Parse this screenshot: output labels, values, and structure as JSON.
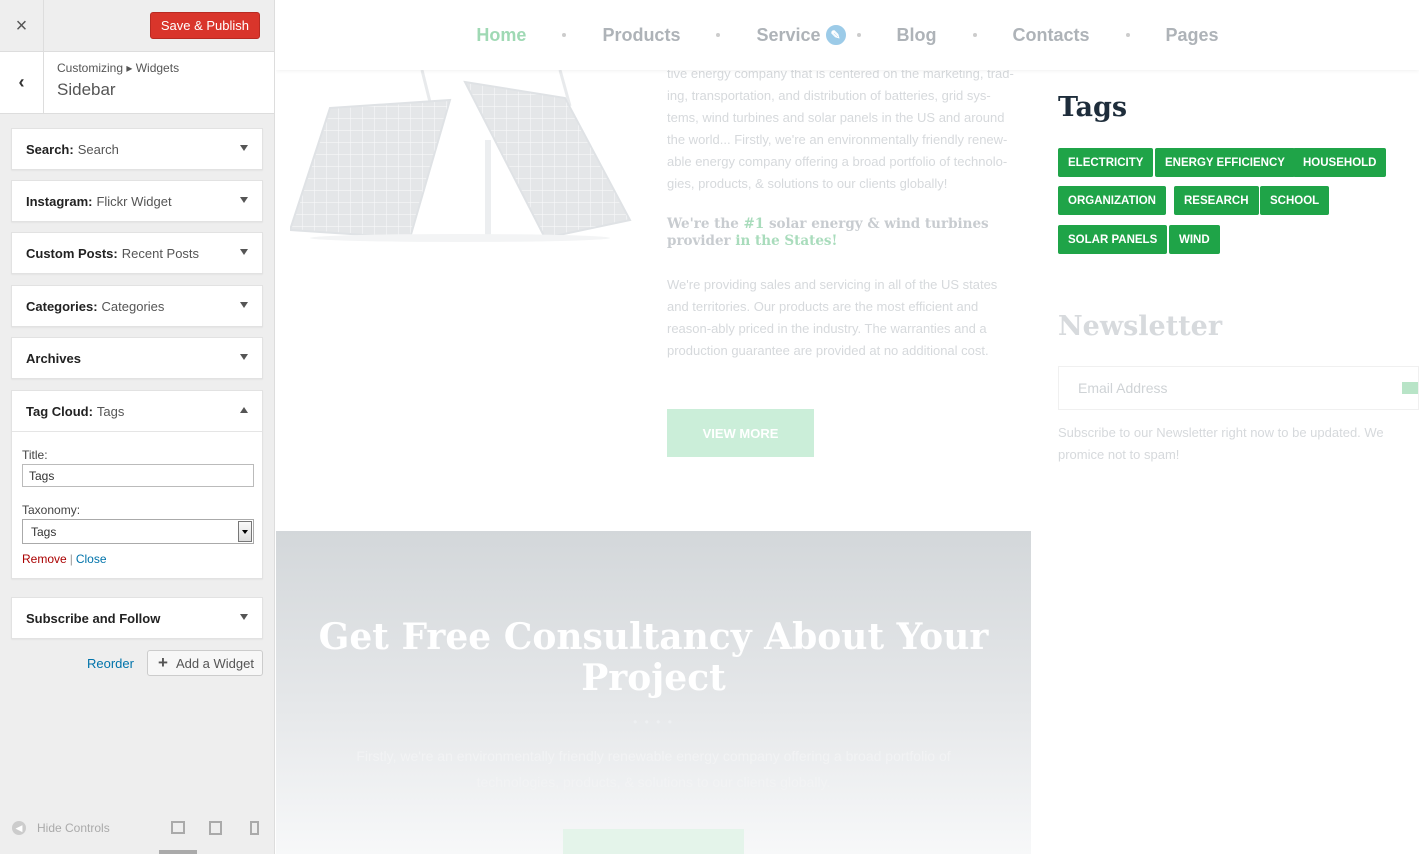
{
  "customizer": {
    "close_label": "×",
    "publish_label": "Save & Publish",
    "breadcrumb": "Customizing ▸ Widgets",
    "section_title": "Sidebar",
    "widgets": [
      {
        "type": "Search:",
        "name": "Search"
      },
      {
        "type": "Instagram:",
        "name": "Flickr Widget"
      },
      {
        "type": "Custom Posts:",
        "name": "Recent Posts"
      },
      {
        "type": "Categories:",
        "name": "Categories"
      },
      {
        "type": "Archives",
        "name": ""
      },
      {
        "type": "Tag Cloud:",
        "name": "Tags"
      },
      {
        "type": "Subscribe and Follow",
        "name": ""
      }
    ],
    "tag_cloud_form": {
      "title_label": "Title:",
      "title_value": "Tags",
      "taxonomy_label": "Taxonomy:",
      "taxonomy_value": "Tags",
      "remove_label": "Remove",
      "separator": "|",
      "close_label": "Close"
    },
    "reorder_label": "Reorder",
    "add_widget_label": "Add a Widget",
    "hide_controls_label": "Hide Controls"
  },
  "preview": {
    "nav": [
      "Home",
      "Products",
      "Service",
      "Blog",
      "Contacts",
      "Pages"
    ],
    "about_text": "tive energy company that is centered on the marketing, trad-ing, transportation, and distribution of batteries, grid sys-tems, wind turbines and solar panels in the US and around the world... Firstly, we're an environmentally friendly renew-able energy company offering a broad portfolio of technolo-gies, products, & solutions to our clients globally!",
    "strong_prefix": "We're the ",
    "strong_highlight1": "#1",
    "strong_middle": " solar energy & wind turbines provider ",
    "strong_highlight2": "in the States!",
    "about_text2": "We're providing sales and servicing in all of the US states and territories. Our products are the most efficient and reason-ably priced in the industry. The warranties and a production guarantee are provided at no additional cost.",
    "view_more": "VIEW MORE",
    "tags_title": "Tags",
    "tags": [
      "ELECTRICITY",
      "ENERGY EFFICIENCY",
      "HOUSEHOLD",
      "ORGANIZATION",
      "RESEARCH",
      "SCHOOL",
      "SOLAR PANELS",
      "WIND"
    ],
    "newsletter_title": "Newsletter",
    "email_placeholder": "Email Address",
    "newsletter_note": "Subscribe to our Newsletter right now to be updated. We promice not to spam!",
    "cta_title": "Get Free Consultancy About Your Project",
    "cta_dots": "• • • •",
    "cta_text": "Firstly, we're an environmentally friendly renewable energy company offering a broad portfolio of technologies, products, & solutions to our clients globally."
  },
  "colors": {
    "publish": "#d9352b",
    "tag_green": "#1fa448",
    "link_blue": "#0073aa",
    "remove_red": "#aa0000"
  }
}
